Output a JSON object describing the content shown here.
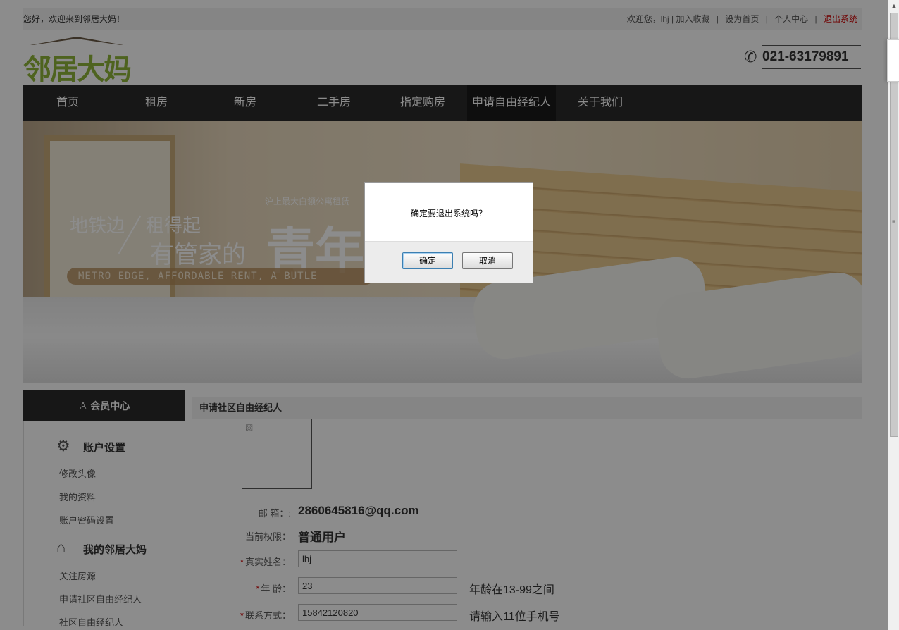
{
  "topbar": {
    "welcome": "您好，欢迎来到邻居大妈！",
    "greeting": "欢迎您，lhj |",
    "favorite": "加入收藏",
    "homepage": "设为首页",
    "user_center": "个人中心",
    "logout": "退出系统",
    "sep": "|"
  },
  "logo": {
    "text": "邻居大妈"
  },
  "phone": {
    "icon": "phone-icon",
    "number": "021-63179891"
  },
  "nav": {
    "items": [
      "首页",
      "租房",
      "新房",
      "二手房",
      "指定购房",
      "申请自由经纪人",
      "关于我们"
    ],
    "active_index": 5
  },
  "banner": {
    "line1": "地铁边",
    "line2": "租得起",
    "line3": "有管家的",
    "big": "青年",
    "small": "沪上最大白领公寓租赁",
    "english": "METRO EDGE, AFFORDABLE RENT, A BUTLE"
  },
  "sidebar": {
    "header": "会员中心",
    "header_icon": "user-icon",
    "groups": [
      {
        "title": "账户设置",
        "icon": "gear-icon",
        "items": [
          "修改头像",
          "我的资料",
          "账户密码设置"
        ]
      },
      {
        "title": "我的邻居大妈",
        "icon": "home-icon",
        "items": [
          "关注房源",
          "申请社区自由经纪人",
          "社区自由经纪人"
        ]
      }
    ]
  },
  "content": {
    "title": "申请社区自由经纪人",
    "email_label": "邮  箱：:",
    "email_value": "2860645816@qq.com",
    "role_label": "当前权限：",
    "role_value": "普通用户",
    "name_label": "真实姓名：",
    "name_value": "lhj",
    "age_label": "年  龄：",
    "age_value": "23",
    "age_hint": "年龄在13-99之间",
    "phone_label": "联系方式：",
    "phone_value": "15842120820",
    "phone_hint": "请输入11位手机号",
    "required_mark": "*"
  },
  "dialog": {
    "message": "确定要退出系统吗？",
    "ok": "确定",
    "cancel": "取消"
  },
  "colors": {
    "nav_bg": "#2b2b2b",
    "logo_green": "#8fb53a",
    "logout_red": "#cc0000",
    "overlay": "rgba(0,0,0,0.45)"
  }
}
